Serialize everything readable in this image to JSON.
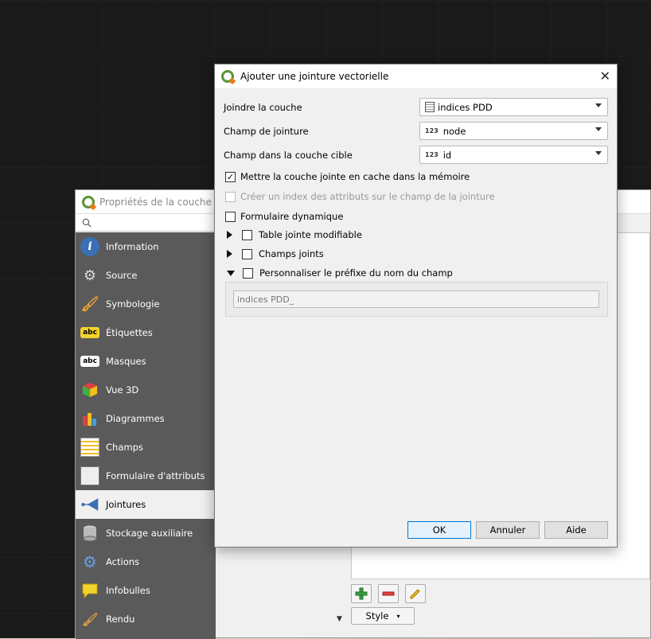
{
  "props_window": {
    "title": "Propriétés de la couche - Gr",
    "sidebar": [
      {
        "label": "Information",
        "icon": "info-icon"
      },
      {
        "label": "Source",
        "icon": "source-icon"
      },
      {
        "label": "Symbologie",
        "icon": "paintbrush-icon"
      },
      {
        "label": "Étiquettes",
        "icon": "labels-abc-icon"
      },
      {
        "label": "Masques",
        "icon": "masks-abc-icon"
      },
      {
        "label": "Vue 3D",
        "icon": "cube-3d-icon"
      },
      {
        "label": "Diagrammes",
        "icon": "diagram-icon"
      },
      {
        "label": "Champs",
        "icon": "fields-icon"
      },
      {
        "label": "Formulaire d'attributs",
        "icon": "form-icon"
      },
      {
        "label": "Jointures",
        "icon": "join-icon",
        "active": true
      },
      {
        "label": "Stockage auxiliaire",
        "icon": "database-icon"
      },
      {
        "label": "Actions",
        "icon": "actions-gear-icon"
      },
      {
        "label": "Infobulles",
        "icon": "tooltip-bubble-icon"
      },
      {
        "label": "Rendu",
        "icon": "rendering-brush-icon"
      }
    ],
    "style_label": "Style"
  },
  "dialog": {
    "title": "Ajouter une jointure vectorielle",
    "fields": {
      "join_layer": {
        "label": "Joindre la couche",
        "value": "indices PDD"
      },
      "join_field": {
        "label": "Champ de jointure",
        "value": "node",
        "badge": "123"
      },
      "target_field": {
        "label": "Champ dans la couche cible",
        "value": "id",
        "badge": "123"
      }
    },
    "options": {
      "cache": {
        "label": "Mettre la couche jointe en cache dans la mémoire",
        "checked": true
      },
      "index": {
        "label": "Créer un index des attributs sur le champ de la jointure",
        "checked": false
      },
      "dynamic_form": {
        "label": "Formulaire dynamique",
        "checked": false
      }
    },
    "groups": {
      "editable": {
        "label": "Table jointe modifiable"
      },
      "joined_fields": {
        "label": "Champs joints"
      },
      "prefix": {
        "label": "Personnaliser le préfixe du nom du champ",
        "value": "indices PDD_"
      }
    },
    "buttons": {
      "ok": "OK",
      "cancel": "Annuler",
      "help": "Aide"
    }
  }
}
